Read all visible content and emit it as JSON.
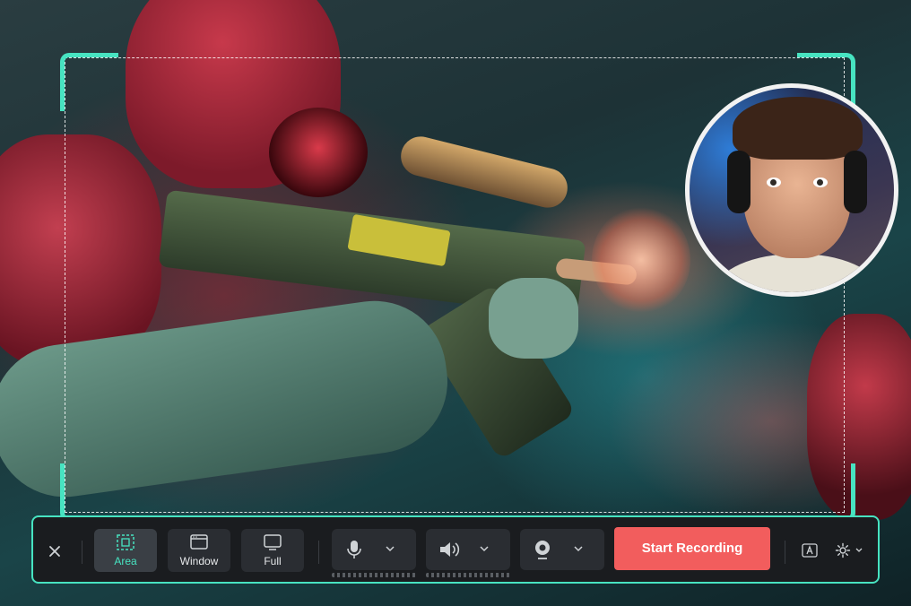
{
  "toolbar": {
    "close_icon": "close-icon",
    "modes": [
      {
        "label": "Area",
        "icon": "area-select-icon",
        "active": true
      },
      {
        "label": "Window",
        "icon": "window-icon",
        "active": false
      },
      {
        "label": "Full",
        "icon": "monitor-icon",
        "active": false
      }
    ],
    "devices": [
      {
        "icon": "microphone-icon",
        "dropdown_icon": "chevron-down-icon"
      },
      {
        "icon": "speaker-icon",
        "dropdown_icon": "chevron-down-icon"
      },
      {
        "icon": "webcam-icon",
        "dropdown_icon": "chevron-down-icon"
      }
    ],
    "start_label": "Start Recording",
    "caption_icon": "caption-a-icon",
    "settings_icon": "gear-icon"
  },
  "colors": {
    "accent": "#47e3c1",
    "record": "#f25d5d",
    "toolbar_bg": "#1a1c1f"
  }
}
